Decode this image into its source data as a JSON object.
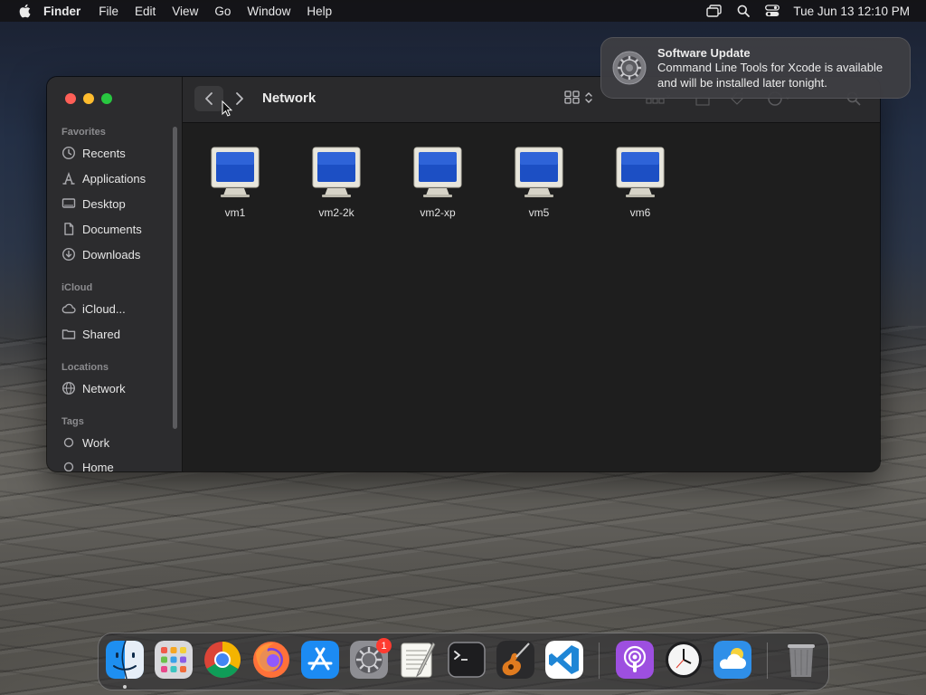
{
  "menubar": {
    "app_name": "Finder",
    "items": [
      "File",
      "Edit",
      "View",
      "Go",
      "Window",
      "Help"
    ],
    "clock": "Tue Jun 13  12:10 PM"
  },
  "notification": {
    "title": "Software Update",
    "body_line1": "Command Line Tools for Xcode is available",
    "body_line2": "and will be installed later tonight."
  },
  "finder": {
    "title": "Network",
    "sidebar": {
      "favorites_header": "Favorites",
      "favorites": [
        "Recents",
        "Applications",
        "Desktop",
        "Documents",
        "Downloads"
      ],
      "icloud_header": "iCloud",
      "icloud": [
        "iCloud...",
        "Shared"
      ],
      "locations_header": "Locations",
      "locations": [
        "Network"
      ],
      "tags_header": "Tags",
      "tags": [
        "Work",
        "Home"
      ]
    },
    "items": [
      "vm1",
      "vm2-2k",
      "vm2-xp",
      "vm5",
      "vm6"
    ]
  },
  "dock": {
    "apps": [
      "finder",
      "launchpad",
      "chrome",
      "firefox",
      "app-store",
      "system-settings",
      "textedit",
      "terminal",
      "garageband",
      "vscode",
      "podcasts",
      "clock",
      "weather",
      "trash"
    ],
    "system_settings_badge": "1"
  },
  "colors": {
    "accent": "#0a84ff",
    "close": "#ff5f57",
    "minimize": "#febc2e",
    "maximize": "#28c840"
  }
}
